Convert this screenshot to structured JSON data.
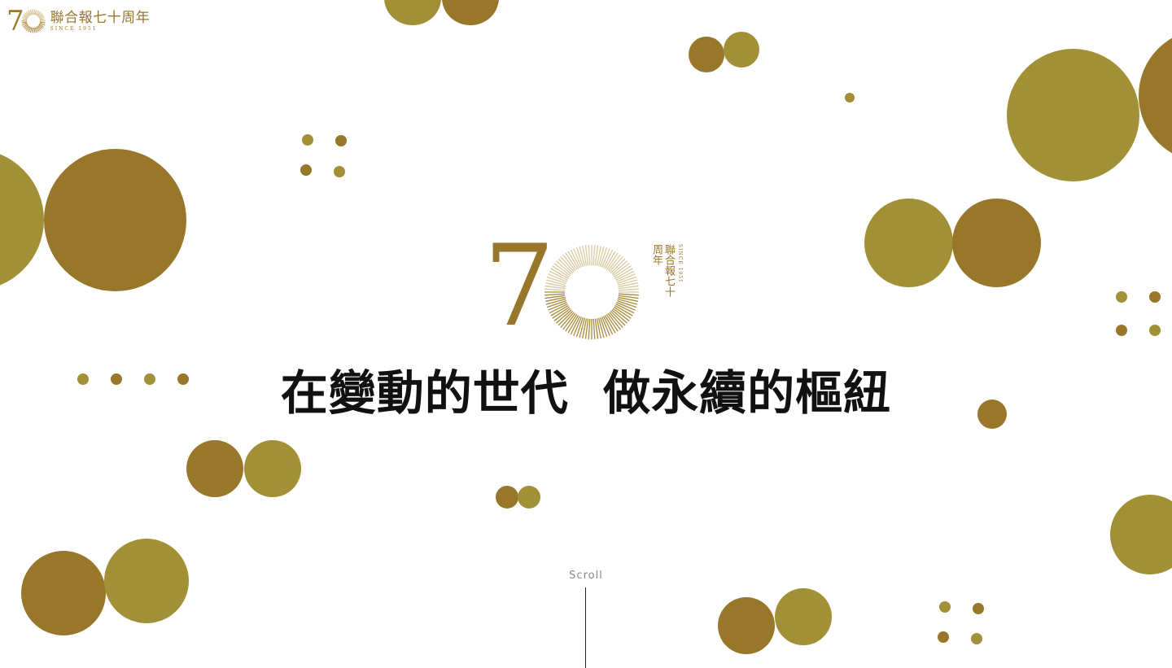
{
  "header": {
    "logo_number": "7",
    "logo_name": "聯合報七十周年",
    "logo_since": "SINCE 1951"
  },
  "hero": {
    "logo_number": "7",
    "logo_name": "聯合報七十周年",
    "logo_since": "SINCE 1951",
    "headline": "在變動的世代  做永續的樞紐"
  },
  "scroll": {
    "label": "Scroll"
  },
  "colors": {
    "olive": "#a19035",
    "brown": "#98762a",
    "text": "#111111"
  }
}
